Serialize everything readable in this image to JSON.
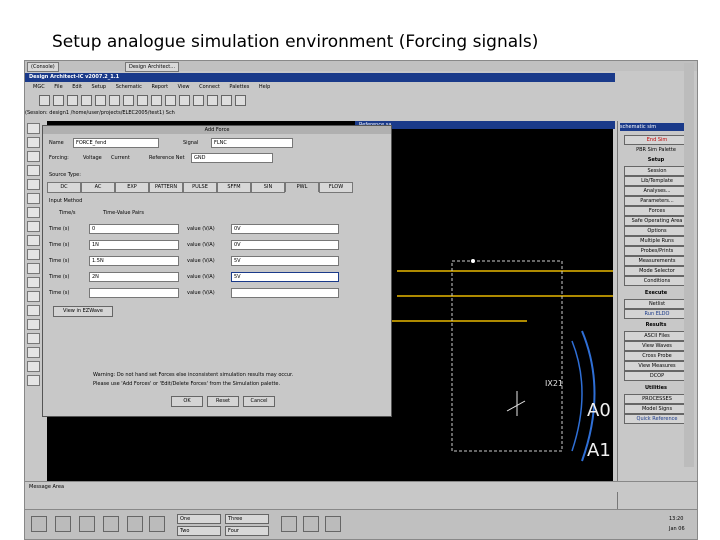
{
  "slide_title": "Setup analogue simulation environment (Forcing signals)",
  "window_tabs": [
    "(Console)",
    "Design Architect..."
  ],
  "app_title": "Design Architect-IC v2007.2_1.1",
  "menu": [
    "MGC",
    "File",
    "Edit",
    "Setup",
    "Schematic",
    "Report",
    "View",
    "Connect",
    "Palettes",
    "Help"
  ],
  "path_text": "(Session: design1 /home/user/projects/ELEC2005/test1) Sch",
  "schematic_title": "Reference sa",
  "dialog": {
    "title": "Add Force",
    "name_label": "Name",
    "name_value": "FORCE_fend",
    "signal_label": "Signal",
    "signal_value": "FLNC",
    "forcing_label": "Forcing:",
    "forcing_options": [
      "Voltage",
      "Current"
    ],
    "ref_label": "Reference Net",
    "ref_value": "GND",
    "source_type_label": "Source Type:",
    "tabs": [
      "DC",
      "AC",
      "EXP",
      "PATTERN",
      "PULSE",
      "SFFM",
      "SIN",
      "PWL",
      "FLOW"
    ],
    "active_tab": "PWL",
    "input_method_label": "Input Method",
    "input_options": [
      "Time/s",
      "Time-Value Pairs"
    ],
    "rows": [
      {
        "time_label": "Time (s)",
        "time": "0",
        "value_label": "value (V/A)",
        "value": "0V"
      },
      {
        "time_label": "Time (s)",
        "time": "1N",
        "value_label": "value (V/A)",
        "value": "0V"
      },
      {
        "time_label": "Time (s)",
        "time": "1.5N",
        "value_label": "value (V/A)",
        "value": "5V"
      },
      {
        "time_label": "Time (s)",
        "time": "2N",
        "value_label": "value (V/A)",
        "value": "5V"
      },
      {
        "time_label": "Time (s)",
        "time": "",
        "value_label": "value (V/A)",
        "value": ""
      }
    ],
    "ezwave_button": "View in EZWave",
    "warning_lines": [
      "Warning: Do not hand set Forces else inconsistent simulation results may occur.",
      "Please use 'Add Forces' or 'Edit/Delete Forces' from the Simulation palette."
    ],
    "ok": "OK",
    "reset": "Reset",
    "cancel": "Cancel"
  },
  "palette": {
    "title": "schematic sim",
    "end_sim": "End Sim",
    "pbr_title": "PBR Sim Palette",
    "setup_hdr": "Setup",
    "setup_items": [
      "Session",
      "Lib/Template",
      "Analyses...",
      "Parameters...",
      "Forces",
      "Safe Operating Area",
      "Options",
      "Multiple Runs",
      "Probes/Prints",
      "Measurements",
      "Mode Selector",
      "Conditions"
    ],
    "execute_hdr": "Execute",
    "execute_items": [
      "Netlist",
      "Run ELDO"
    ],
    "results_hdr": "Results",
    "results_items": [
      "ASCII Files",
      "View Waves",
      "Cross Probe",
      "View Measures",
      "DCOP"
    ],
    "utilities_hdr": "Utilities",
    "utilities_items": [
      "PROCESSES",
      "Model Signs",
      "Quick Reference"
    ]
  },
  "canvas_text": [
    "A0",
    "A1",
    "IX21"
  ],
  "message_area": "Message Area",
  "workspaces": [
    "One",
    "Three",
    "Two",
    "Four"
  ],
  "clock_time": "13:20",
  "clock_date": "Jan 06",
  "colors": {
    "titlebar": "#1a3a8a",
    "canvas": "#000000",
    "wire": "#e8b800",
    "arc": "#2f6fd6"
  }
}
